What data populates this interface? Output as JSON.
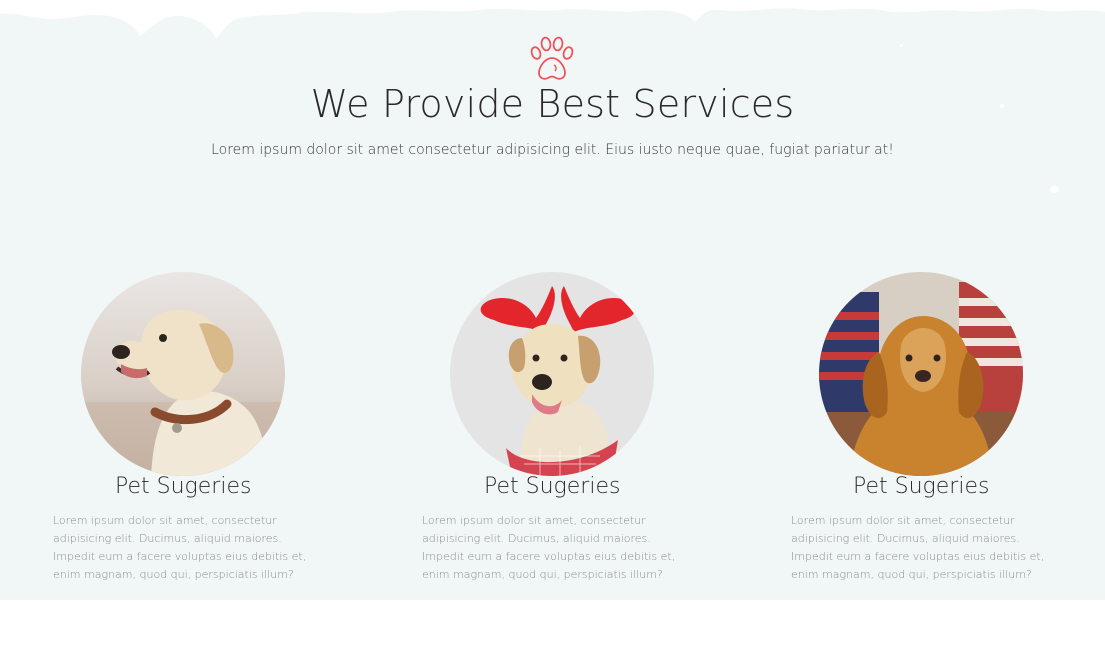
{
  "header": {
    "icon": "paw-icon",
    "accent_color": "#f0535a",
    "title": "We Provide Best Services",
    "subtitle": "Lorem ipsum dolor sit amet consectetur adipisicing elit. Eius iusto neque quae, fugiat pariatur at!"
  },
  "services": [
    {
      "image": "labrador-dog-photo",
      "title": "Pet Sugeries",
      "text": "Lorem ipsum dolor sit amet, consectetur adipisicing elit. Ducimus, aliquid maiores. Impedit eum a facere voluptas eius debitis et, enim magnam, quod qui, perspiciatis illum?"
    },
    {
      "image": "reindeer-antlers-dog-photo",
      "title": "Pet Sugeries",
      "text": "Lorem ipsum dolor sit amet, consectetur adipisicing elit. Ducimus, aliquid maiores. Impedit eum a facere voluptas eius debitis et, enim magnam, quod qui, perspiciatis illum?"
    },
    {
      "image": "golden-retriever-photo",
      "title": "Pet Sugeries",
      "text": "Lorem ipsum dolor sit amet, consectetur adipisicing elit. Ducimus, aliquid maiores. Impedit eum a facere voluptas eius debitis et, enim magnam, quod qui, perspiciatis illum?"
    }
  ],
  "colors": {
    "section_bg": "#f1f6f6",
    "page_bg": "#ffffff",
    "heading": "#2a2a2a",
    "body_text": "#8a8a8a"
  }
}
